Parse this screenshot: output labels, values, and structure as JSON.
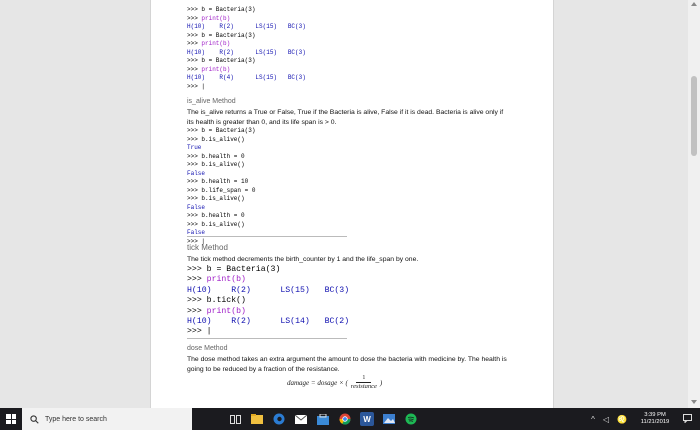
{
  "code_block_1": {
    "lines": [
      {
        "prompt": ">>> ",
        "code": "b = Bacteria(3)",
        "kind": "input"
      },
      {
        "prompt": ">>> ",
        "code": "print(b)",
        "kind": "print"
      },
      {
        "prompt": "",
        "code": "H(10)    R(2)      LS(15)   BC(3)",
        "kind": "output"
      },
      {
        "prompt": ">>> ",
        "code": "b = Bacteria(3)",
        "kind": "input"
      },
      {
        "prompt": ">>> ",
        "code": "print(b)",
        "kind": "print"
      },
      {
        "prompt": "",
        "code": "H(10)    R(2)      LS(15)   BC(3)",
        "kind": "output"
      },
      {
        "prompt": ">>> ",
        "code": "b = Bacteria(3)",
        "kind": "input"
      },
      {
        "prompt": ">>> ",
        "code": "print(b)",
        "kind": "print"
      },
      {
        "prompt": "",
        "code": "H(10)    R(4)      LS(15)   BC(3)",
        "kind": "output"
      },
      {
        "prompt": ">>> ",
        "code": "|",
        "kind": "input"
      }
    ]
  },
  "is_alive": {
    "heading": "is_alive Method",
    "text": "The is_alive returns a True or False, True if the Bacteria is alive, False if it is dead.  Bacteria is alive only if its health is greater than 0, and its life span is > 0.",
    "lines": [
      {
        "prompt": ">>> ",
        "code": "b = Bacteria(3)",
        "kind": "input"
      },
      {
        "prompt": ">>> ",
        "code": "b.is_alive()",
        "kind": "input"
      },
      {
        "prompt": "",
        "code": "True",
        "kind": "output"
      },
      {
        "prompt": ">>> ",
        "code": "b.health = 0",
        "kind": "input"
      },
      {
        "prompt": ">>> ",
        "code": "b.is_alive()",
        "kind": "input"
      },
      {
        "prompt": "",
        "code": "False",
        "kind": "output"
      },
      {
        "prompt": ">>> ",
        "code": "b.health = 10",
        "kind": "input"
      },
      {
        "prompt": ">>> ",
        "code": "b.life_span = 0",
        "kind": "input"
      },
      {
        "prompt": ">>> ",
        "code": "b.is_alive()",
        "kind": "input"
      },
      {
        "prompt": "",
        "code": "False",
        "kind": "output"
      },
      {
        "prompt": ">>> ",
        "code": "b.health = 0",
        "kind": "input"
      },
      {
        "prompt": ">>> ",
        "code": "b.is_alive()",
        "kind": "input"
      },
      {
        "prompt": "",
        "code": "False",
        "kind": "output"
      },
      {
        "prompt": ">>> ",
        "code": "|",
        "kind": "input"
      }
    ]
  },
  "tick": {
    "heading": "tick Method",
    "text": "The tick method decrements the birth_counter by 1 and the life_span by one.",
    "lines": [
      {
        "prompt": ">>> ",
        "code": "b = Bacteria(3)",
        "kind": "input"
      },
      {
        "prompt": ">>> ",
        "code": "print(b)",
        "kind": "print"
      },
      {
        "prompt": "",
        "code": "H(10)    R(2)      LS(15)   BC(3)",
        "kind": "output"
      },
      {
        "prompt": ">>> ",
        "code": "b.tick()",
        "kind": "input"
      },
      {
        "prompt": ">>> ",
        "code": "print(b)",
        "kind": "print"
      },
      {
        "prompt": "",
        "code": "H(10)    R(2)      LS(14)   BC(2)",
        "kind": "output"
      },
      {
        "prompt": ">>> ",
        "code": "|",
        "kind": "input"
      }
    ]
  },
  "dose": {
    "heading": "dose Method",
    "text": "The dose method takes an extra argument the amount to dose the bacteria with medicine by.  The health is going to be reduced by a fraction of the resistance.",
    "formula": {
      "lhs": "damage = dosage × (",
      "numerator": "1",
      "denominator": "resistance",
      "rhs": ")"
    }
  },
  "taskbar": {
    "search_placeholder": "Type here to search",
    "time": "3:39 PM",
    "date": "11/21/2019",
    "apps": [
      "task-view-icon",
      "file-explorer-icon",
      "edge-icon",
      "mail-icon",
      "store-icon",
      "chrome-icon",
      "word-icon",
      "photos-icon",
      "spotify-icon"
    ]
  }
}
